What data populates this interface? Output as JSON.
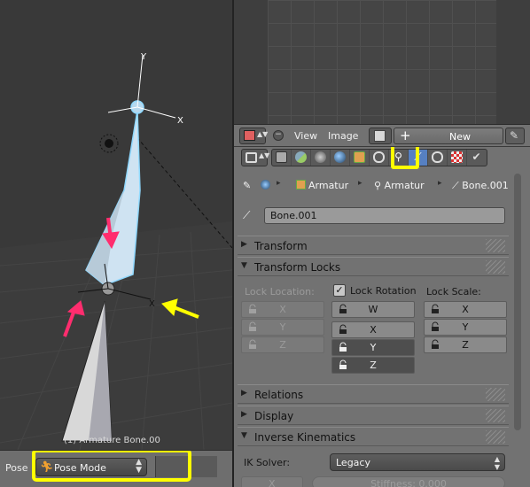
{
  "viewport": {
    "info_text": "(1) Armature Bone.00",
    "header": {
      "mode_label": "Pose",
      "mode_select_value": "Pose Mode"
    },
    "axis_labels": {
      "top_y": "Y",
      "top_x": "X",
      "bottom_x": "X"
    }
  },
  "image_editor": {
    "menu_view": "View",
    "menu_image": "Image",
    "new_button": "New"
  },
  "properties": {
    "active_tab": "bone",
    "path": [
      "Armatur",
      "Armatur",
      "Bone.001"
    ],
    "bone_name": "Bone.001",
    "panels": {
      "transform": "Transform",
      "transform_locks": "Transform Locks",
      "relations": "Relations",
      "display": "Display",
      "inverse_kinematics": "Inverse Kinematics"
    },
    "locks": {
      "location_label": "Lock Location:",
      "rotation_label": "Lock Rotation",
      "rotation_checked": true,
      "scale_label": "Lock Scale:",
      "location_axes": [
        "X",
        "Y",
        "Z"
      ],
      "rotation_axes": [
        "W",
        "X",
        "Y",
        "Z"
      ],
      "scale_axes": [
        "X",
        "Y",
        "Z"
      ]
    },
    "ik": {
      "solver_label": "IK Solver:",
      "solver_value": "Legacy",
      "stiffness_axis": "X",
      "stiffness_value": "Stiffness: 0.000"
    }
  },
  "colors": {
    "annotation_yellow": "#ffff00",
    "annotation_pink": "#ff2d6e",
    "active_tab_blue": "#5680c2",
    "bone_fill": "#cfe3f2",
    "bone_outline": "#8fd8ff"
  }
}
